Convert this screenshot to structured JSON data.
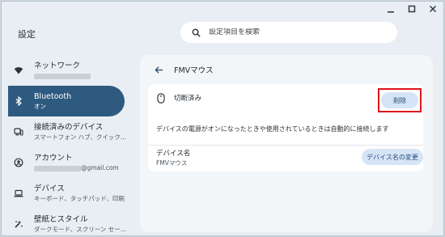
{
  "window": {
    "controls": [
      "minimize-icon",
      "restore-icon",
      "close-icon"
    ]
  },
  "app": {
    "title": "設定"
  },
  "search": {
    "placeholder": "設定項目を検索"
  },
  "sidebar": {
    "items": [
      {
        "title": "ネットワーク",
        "subtitle": "",
        "icon": "wifi-icon"
      },
      {
        "title": "Bluetooth",
        "subtitle": "オン",
        "icon": "bluetooth-icon",
        "active": true
      },
      {
        "title": "接続済みのデバイス",
        "subtitle": "スマートフォン ハブ、クイック...",
        "icon": "devices-icon"
      },
      {
        "title": "アカウント",
        "subtitle": "@gmail.com",
        "icon": "account-icon"
      },
      {
        "title": "デバイス",
        "subtitle": "キーボード、タッチパッド、印刷",
        "icon": "laptop-icon"
      },
      {
        "title": "壁紙とスタイル",
        "subtitle": "ダークモード、スクリーン セー...",
        "icon": "palette-icon"
      }
    ]
  },
  "main": {
    "title": "FMVマウス",
    "status": "切断済み",
    "delete_label": "削除",
    "description": "デバイスの電源がオンになったときや使用されているときは自動的に接続します",
    "device_name_label": "デバイス名",
    "device_name_value": "FMVマウス",
    "rename_label": "デバイス名の変更"
  },
  "colors": {
    "active_nav": "#2f5a80",
    "button_bg": "#d6e5f6",
    "highlight": "#e0161c"
  }
}
